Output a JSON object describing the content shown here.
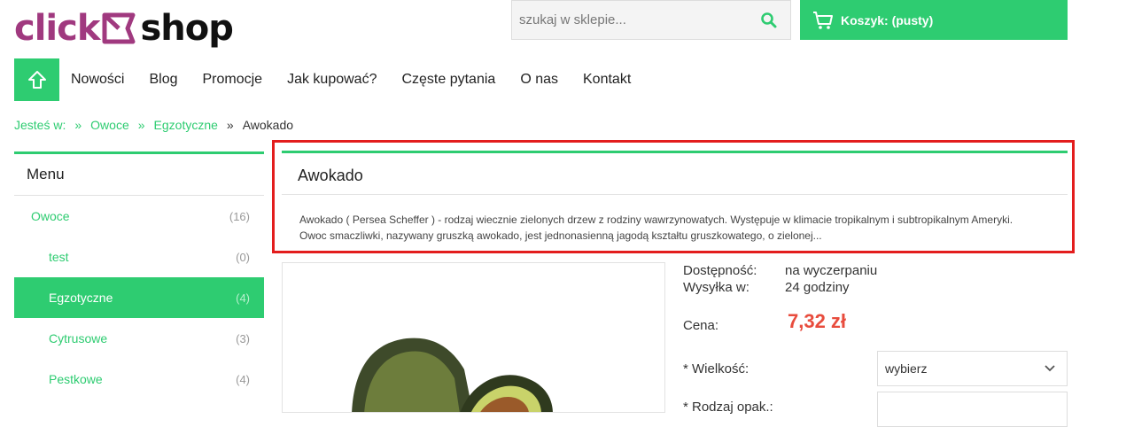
{
  "header": {
    "logo_left": "click",
    "logo_right": "shop",
    "search_placeholder": "szukaj w sklepie...",
    "cart_label": "Koszyk: (pusty)"
  },
  "nav": {
    "items": [
      "Nowości",
      "Blog",
      "Promocje",
      "Jak kupować?",
      "Częste pytania",
      "O nas",
      "Kontakt"
    ]
  },
  "breadcrumb": {
    "label": "Jesteś w:",
    "sep": "»",
    "items": [
      "Owoce",
      "Egzotyczne"
    ],
    "current": "Awokado"
  },
  "sidebar": {
    "title": "Menu",
    "items": [
      {
        "label": "Owoce",
        "count": "(16)"
      },
      {
        "label": "test",
        "count": "(0)"
      },
      {
        "label": "Egzotyczne",
        "count": "(4)"
      },
      {
        "label": "Cytrusowe",
        "count": "(3)"
      },
      {
        "label": "Pestkowe",
        "count": "(4)"
      }
    ]
  },
  "product": {
    "title": "Awokado",
    "description_line1": "Awokado ( Persea Scheffer ) - rodzaj wiecznie zielonych drzew z rodziny wawrzynowatych. Występuje w klimacie tropikalnym i subtropikalnym Ameryki.",
    "description_line2": "Owoc smaczliwki, nazywany gruszką awokado, jest jednonasienną jagodą kształtu gruszkowatego, o zielonej...",
    "availability_label": "Dostępność:",
    "availability_value": "na wyczerpaniu",
    "shipping_label": "Wysyłka w:",
    "shipping_value": "24 godziny",
    "price_label": "Cena:",
    "price_value": "7,32 zł",
    "size_label": "* Wielkość:",
    "size_select_value": "wybierz",
    "next_label": "* Rodzaj opak.:"
  },
  "colors": {
    "accent": "#2ecc71",
    "price": "#e84c3d",
    "highlight": "#e31d1d",
    "logo": "#a0397f"
  }
}
